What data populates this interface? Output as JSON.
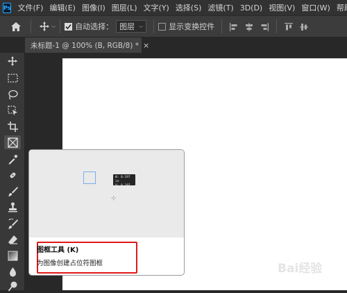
{
  "menubar": {
    "logo": "Ps",
    "items": [
      "文件(F)",
      "编辑(E)",
      "图像(I)",
      "图层(L)",
      "文字(Y)",
      "选择(S)",
      "滤镜(T)",
      "3D(D)",
      "视图(V)",
      "窗口(W)",
      "帮助(H)"
    ]
  },
  "options": {
    "auto_select_label": "自动选择：",
    "auto_select_checked": true,
    "target_value": "图层",
    "show_transform_label": "显示变换控件",
    "show_transform_checked": false
  },
  "tab": {
    "title": "未标题-1 @ 100% (B, RGB/8) *",
    "close": "×"
  },
  "toolbar": {
    "collapse_label": "››",
    "tools": [
      "move-icon",
      "marquee-icon",
      "lasso-icon",
      "object-select-icon",
      "crop-icon",
      "frame-icon",
      "eyedropper-icon",
      "healing-brush-icon",
      "brush-icon",
      "stamp-icon",
      "history-brush-icon",
      "eraser-icon",
      "gradient-icon",
      "blur-icon",
      "dodge-icon"
    ],
    "active_tool": "frame-icon"
  },
  "tooltip": {
    "size_line1": "W: 0.197 in",
    "size_line2": "H: 0.197 in",
    "title": "图框工具 (K)",
    "description": "为图像创建占位符图框"
  },
  "watermark": "Bai经验",
  "colors": {
    "highlight": "#e01818",
    "frame_preview": "#7aaaf0"
  }
}
